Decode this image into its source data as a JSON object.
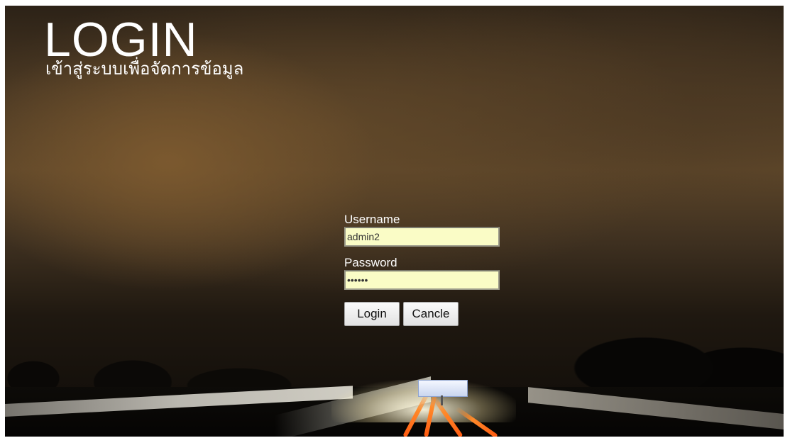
{
  "header": {
    "title": "LOGIN",
    "subtitle": "เข้าสู่ระบบเพื่อจัดการข้อมูล"
  },
  "form": {
    "username_label": "Username",
    "username_value": "admin2",
    "password_label": "Password",
    "password_value": "••••••",
    "login_button": "Login",
    "cancel_button": "Cancle"
  },
  "colors": {
    "input_background": "#fafcc6",
    "text": "#ffffff"
  }
}
